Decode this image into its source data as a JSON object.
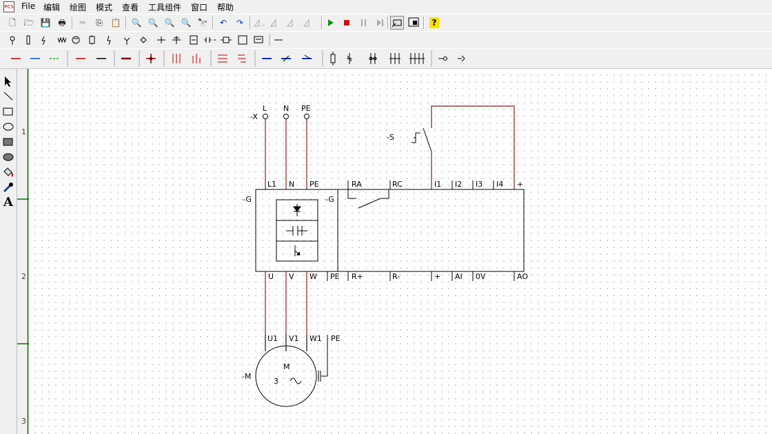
{
  "app": {
    "icon_label": "PCS"
  },
  "menu": [
    "File",
    "编辑",
    "绘图",
    "模式",
    "查看",
    "工具组件",
    "窗口",
    "帮助"
  ],
  "toolbar1": {
    "new": "🗋",
    "open": "🗁",
    "save": "💾",
    "print": "🖶",
    "cut": "✂",
    "copy": "⎘",
    "paste": "📋",
    "zoom_in": "🔍",
    "zoom_out": "🔍",
    "zoom_fit": "🔍",
    "zoom_area": "🔍",
    "find": "🔭",
    "undo": "↶",
    "redo": "↷",
    "help": "?"
  },
  "ruler": [
    "1",
    "2",
    "3"
  ],
  "schematic": {
    "terminal_X": {
      "ref": "-X",
      "labels": [
        "L",
        "N",
        "PE"
      ]
    },
    "switch": {
      "ref": "-S"
    },
    "drive": {
      "ref_outer": "-G",
      "ref_inner": "-G",
      "top_terminals": [
        "L1",
        "N",
        "PE",
        "RA",
        "RC",
        "I1",
        "I2",
        "I3",
        "I4",
        "+"
      ],
      "bottom_terminals": [
        "U",
        "V",
        "W",
        "PE",
        "R+",
        "R-",
        "+",
        "AI",
        "0V",
        "AO"
      ]
    },
    "motor": {
      "ref": "-M",
      "letter": "M",
      "phases": "3",
      "terminals": [
        "U1",
        "V1",
        "W1",
        "PE"
      ]
    }
  },
  "colors": {
    "wire": "#8b1a1a",
    "line": "#000000",
    "ruler_line": "#007000"
  }
}
